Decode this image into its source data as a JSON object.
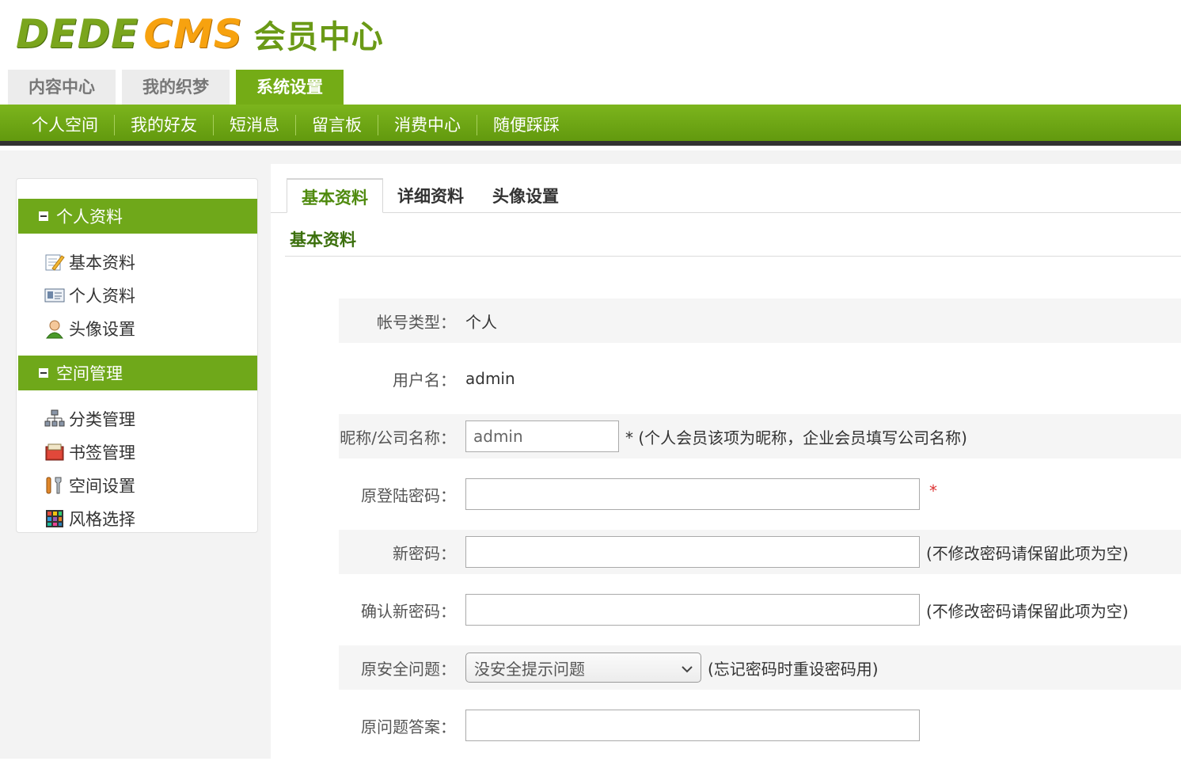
{
  "logo": {
    "brand_a": "DEDE",
    "brand_b": "CMS",
    "subtitle": "会员中心"
  },
  "top_tabs": [
    {
      "label": "内容中心",
      "active": false
    },
    {
      "label": "我的织梦",
      "active": false
    },
    {
      "label": "系统设置",
      "active": true
    }
  ],
  "nav": [
    "个人空间",
    "我的好友",
    "短消息",
    "留言板",
    "消费中心",
    "随便踩踩"
  ],
  "sidebar": {
    "groups": [
      {
        "title": "个人资料",
        "items": [
          {
            "label": "基本资料",
            "icon": "edit-note-icon"
          },
          {
            "label": "个人资料",
            "icon": "id-card-icon"
          },
          {
            "label": "头像设置",
            "icon": "user-avatar-icon"
          }
        ]
      },
      {
        "title": "空间管理",
        "items": [
          {
            "label": "分类管理",
            "icon": "category-tree-icon"
          },
          {
            "label": "书签管理",
            "icon": "bookmark-folder-icon"
          },
          {
            "label": "空间设置",
            "icon": "tools-icon"
          },
          {
            "label": "风格选择",
            "icon": "palette-grid-icon"
          }
        ]
      }
    ]
  },
  "main": {
    "tabs": [
      "基本资料",
      "详细资料",
      "头像设置"
    ],
    "section_title": "基本资料",
    "form": {
      "account_type_label": "帐号类型：",
      "account_type_value": "个人",
      "username_label": "用户名：",
      "username_value": "admin",
      "nickname_label": "昵称/公司名称：",
      "nickname_value": "admin",
      "nickname_hint": "* (个人会员该项为昵称，企业会员填写公司名称)",
      "old_pwd_label": "原登陆密码：",
      "old_pwd_required": "*",
      "new_pwd_label": "新密码：",
      "new_pwd_hint": "(不修改密码请保留此项为空)",
      "confirm_pwd_label": "确认新密码：",
      "confirm_pwd_hint": "(不修改密码请保留此项为空)",
      "question_label": "原安全问题：",
      "question_value": "没安全提示问题",
      "question_hint": "(忘记密码时重设密码用)",
      "answer_label": "原问题答案："
    }
  },
  "colors": {
    "green": "#74ac16",
    "orange": "#f7a20f",
    "dark_bar": "#333333"
  }
}
